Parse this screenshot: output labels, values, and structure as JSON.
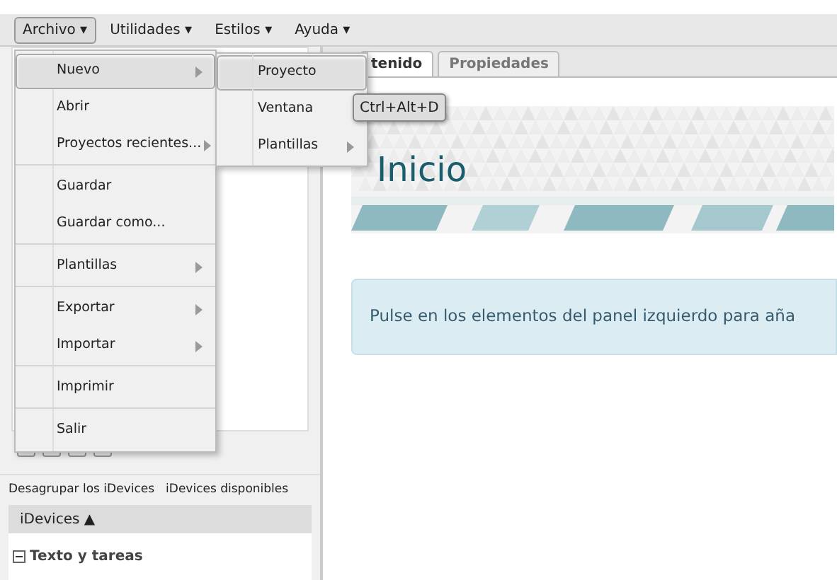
{
  "menubar": [
    {
      "label": "Archivo ▾",
      "selected": true
    },
    {
      "label": "Utilidades ▾",
      "selected": false
    },
    {
      "label": "Estilos ▾",
      "selected": false
    },
    {
      "label": "Ayuda ▾",
      "selected": false
    }
  ],
  "file_menu": [
    [
      {
        "label": "Nuevo",
        "submenu": true,
        "selected": true
      },
      {
        "label": "Abrir",
        "submenu": false,
        "selected": false
      },
      {
        "label": "Proyectos recientes...",
        "submenu": true,
        "selected": false
      }
    ],
    [
      {
        "label": "Guardar",
        "submenu": false,
        "selected": false
      },
      {
        "label": "Guardar como...",
        "submenu": false,
        "selected": false
      }
    ],
    [
      {
        "label": "Plantillas",
        "submenu": true,
        "selected": false
      }
    ],
    [
      {
        "label": "Exportar",
        "submenu": true,
        "selected": false
      },
      {
        "label": "Importar",
        "submenu": true,
        "selected": false
      }
    ],
    [
      {
        "label": "Imprimir",
        "submenu": false,
        "selected": false
      }
    ],
    [
      {
        "label": "Salir",
        "submenu": false,
        "selected": false
      }
    ]
  ],
  "new_submenu": [
    {
      "label": "Proyecto",
      "submenu": false,
      "selected": true
    },
    {
      "label": "Ventana",
      "submenu": false,
      "selected": false
    },
    {
      "label": "Plantillas",
      "submenu": true,
      "selected": false
    }
  ],
  "tooltip": "Ctrl+Alt+D",
  "tabs": [
    {
      "label": "tenido",
      "selected": true
    },
    {
      "label": "Propiedades",
      "selected": false
    }
  ],
  "page_title": "Inicio",
  "info_message": "Pulse en los elementos del panel izquierdo para aña",
  "left_panel": {
    "group_tabs": [
      "Desagrupar los iDevices",
      "iDevices disponibles"
    ],
    "list_header": "iDevices ▲",
    "category": {
      "label": "Texto y tareas",
      "expanded": true
    }
  }
}
